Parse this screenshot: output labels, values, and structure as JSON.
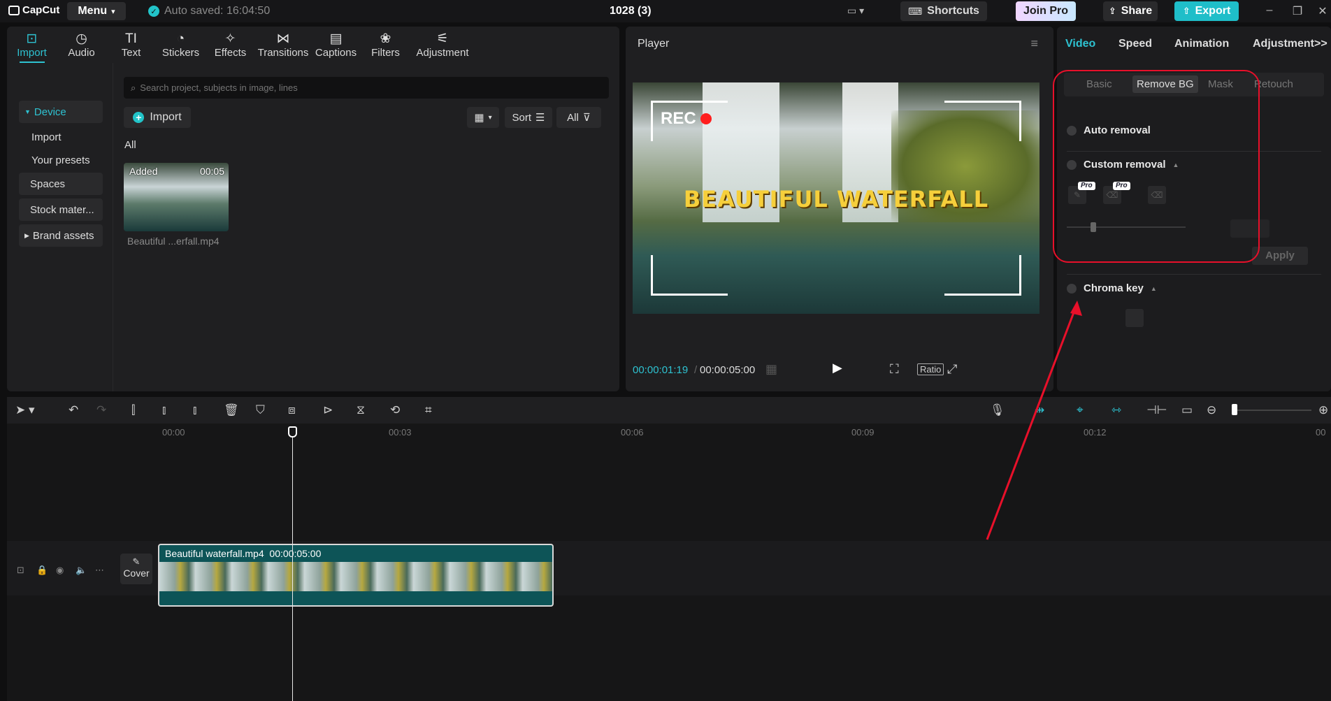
{
  "titlebar": {
    "logo": "CapCut",
    "menu": "Menu",
    "autosaved": "Auto saved: 16:04:50",
    "project_title": "1028 (3)",
    "shortcuts": "Shortcuts",
    "join_pro": "Join Pro",
    "share": "Share",
    "export": "Export"
  },
  "media": {
    "tools": [
      {
        "label": "Import",
        "icon": "import-icon"
      },
      {
        "label": "Audio",
        "icon": "audio-icon"
      },
      {
        "label": "Text",
        "icon": "text-icon"
      },
      {
        "label": "Stickers",
        "icon": "stickers-icon"
      },
      {
        "label": "Effects",
        "icon": "effects-icon"
      },
      {
        "label": "Transitions",
        "icon": "transitions-icon"
      },
      {
        "label": "Captions",
        "icon": "captions-icon"
      },
      {
        "label": "Filters",
        "icon": "filters-icon"
      },
      {
        "label": "Adjustment",
        "icon": "adjustment-icon"
      }
    ],
    "nav": {
      "device": "Device",
      "import": "Import",
      "your_presets": "Your presets",
      "spaces": "Spaces",
      "stock": "Stock mater...",
      "brand_assets": "Brand assets"
    },
    "search_placeholder": "Search project, subjects in image, lines",
    "import_button": "Import",
    "sort": "Sort",
    "all_filter": "All",
    "section_all": "All",
    "asset": {
      "badge": "Added",
      "duration": "00:05",
      "name": "Beautiful ...erfall.mp4"
    }
  },
  "player": {
    "title": "Player",
    "rec_label": "REC",
    "overlay_text": "BEAUTIFUL WATERFALL",
    "current_time": "00:00:01:19",
    "separator": "/",
    "total_time": "00:00:05:00",
    "ratio": "Ratio"
  },
  "properties": {
    "tabs": [
      "Video",
      "Speed",
      "Animation",
      "Adjustment"
    ],
    "subtabs": [
      "Basic",
      "Remove BG",
      "Mask",
      "Retouch"
    ],
    "auto_removal": "Auto removal",
    "custom_removal": "Custom removal",
    "pro_badge": "Pro",
    "apply": "Apply",
    "chroma_key": "Chroma key"
  },
  "timeline": {
    "ticks": [
      "00:00",
      "00:03",
      "00:06",
      "00:09",
      "00:12",
      "00"
    ],
    "cover": "Cover",
    "clip_name": "Beautiful waterfall.mp4",
    "clip_duration": "00:00:05:00"
  },
  "colors": {
    "accent": "#2ec2d1",
    "highlight": "#e8102a",
    "clip": "#0d5457"
  }
}
